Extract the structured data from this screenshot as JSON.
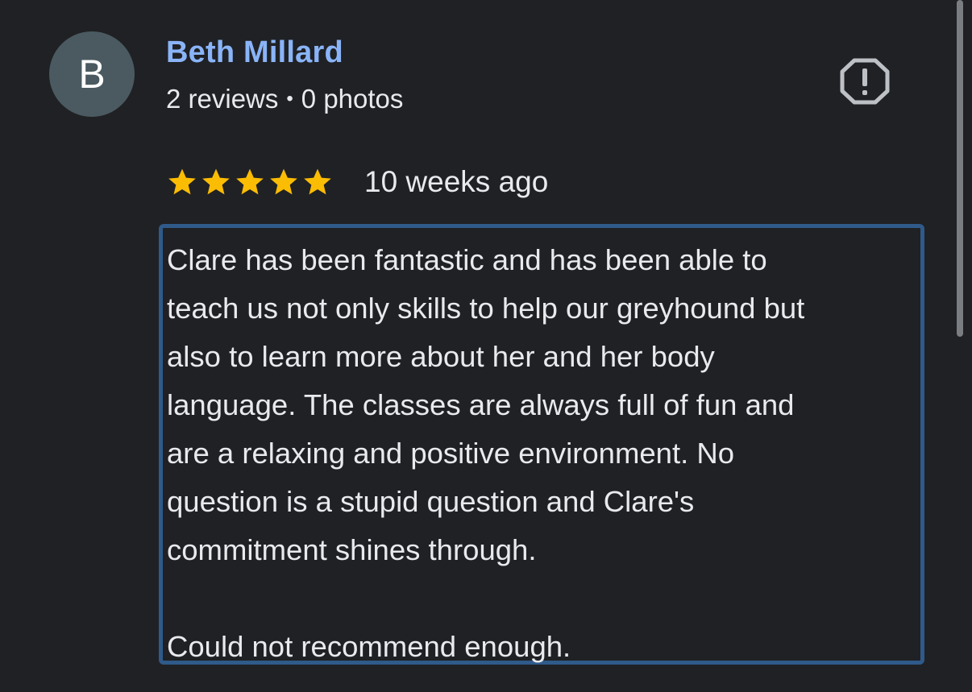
{
  "review": {
    "avatar_letter": "B",
    "author_name": "Beth Millard",
    "reviews_count": "2 reviews",
    "separator": "•",
    "photos_count": "0 photos",
    "rating": 5,
    "rating_max": 5,
    "date": "10 weeks ago",
    "text": "Clare has been fantastic and has been able to\nteach us not only skills to help our greyhound but\nalso to learn more about her and her body\nlanguage. The classes are always full of fun and\nare a relaxing and positive environment. No\nquestion is a stupid question and Clare's\ncommitment shines through.\n\nCould not recommend enough."
  },
  "icons": {
    "report": "report-flag-icon",
    "star": "star-icon"
  },
  "colors": {
    "background": "#202124",
    "author_name": "#8ab4f8",
    "star": "#fbbc04",
    "avatar_bg": "#4a5a60",
    "highlight_border": "#2f5a8a",
    "text": "#e8eaed"
  }
}
